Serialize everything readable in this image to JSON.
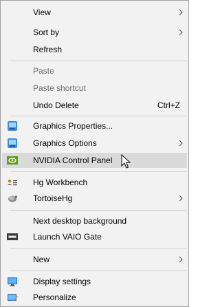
{
  "menu": {
    "items": [
      {
        "label": "View",
        "submenu": true
      },
      {
        "label": "Sort by",
        "submenu": true
      },
      {
        "label": "Refresh"
      },
      {
        "label": "Paste",
        "disabled": true
      },
      {
        "label": "Paste shortcut",
        "disabled": true
      },
      {
        "label": "Undo Delete",
        "shortcut": "Ctrl+Z"
      },
      {
        "label": "Graphics Properties...",
        "icon": "intel-graphics-icon"
      },
      {
        "label": "Graphics Options",
        "icon": "intel-graphics-icon",
        "submenu": true
      },
      {
        "label": "NVIDIA Control Panel",
        "icon": "nvidia-icon",
        "highlighted": true
      },
      {
        "label": "Hg Workbench",
        "icon": "hg-workbench-icon"
      },
      {
        "label": "TortoiseHg",
        "icon": "tortoisehg-icon",
        "submenu": true
      },
      {
        "label": "Next desktop background"
      },
      {
        "label": "Launch VAIO Gate",
        "icon": "vaio-gate-icon"
      },
      {
        "label": "New",
        "submenu": true
      },
      {
        "label": "Display settings",
        "icon": "display-settings-icon"
      },
      {
        "label": "Personalize",
        "icon": "personalize-icon"
      }
    ]
  },
  "colors": {
    "menu_background": "#f2f2f2",
    "hover_background": "#dadada",
    "disabled_text": "#6d6d6d",
    "separator": "#cfcfcf"
  }
}
